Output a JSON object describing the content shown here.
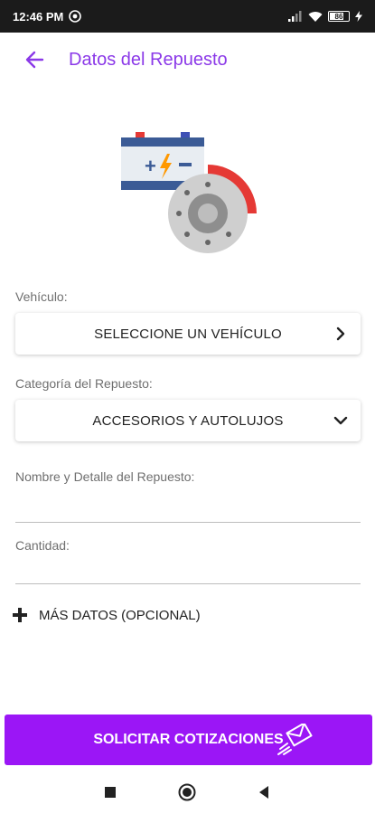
{
  "status_bar": {
    "time": "12:46 PM",
    "battery_level": "86"
  },
  "app_bar": {
    "title": "Datos del Repuesto",
    "back_icon": "arrow-left-icon"
  },
  "illustration": {
    "icon": "battery-and-brake-disc-illustration"
  },
  "form": {
    "vehicle": {
      "label": "Vehículo:",
      "value": "SELECCIONE UN VEHÍCULO",
      "icon": "chevron-right-icon"
    },
    "category": {
      "label": "Categoría del Repuesto:",
      "value": "ACCESORIOS Y AUTOLUJOS",
      "icon": "chevron-down-icon"
    },
    "name_detail": {
      "label": "Nombre y Detalle del Repuesto:",
      "value": ""
    },
    "quantity": {
      "label": "Cantidad:",
      "value": ""
    },
    "more_data": {
      "label": "MÁS DATOS (OPCIONAL)",
      "icon": "plus-icon"
    }
  },
  "cta": {
    "label": "SOLICITAR COTIZACIONES",
    "icon": "send-mail-icon"
  },
  "colors": {
    "accent": "#8b39e8",
    "cta_background": "#9b16f6",
    "status_bar": "#1b1b1b"
  }
}
